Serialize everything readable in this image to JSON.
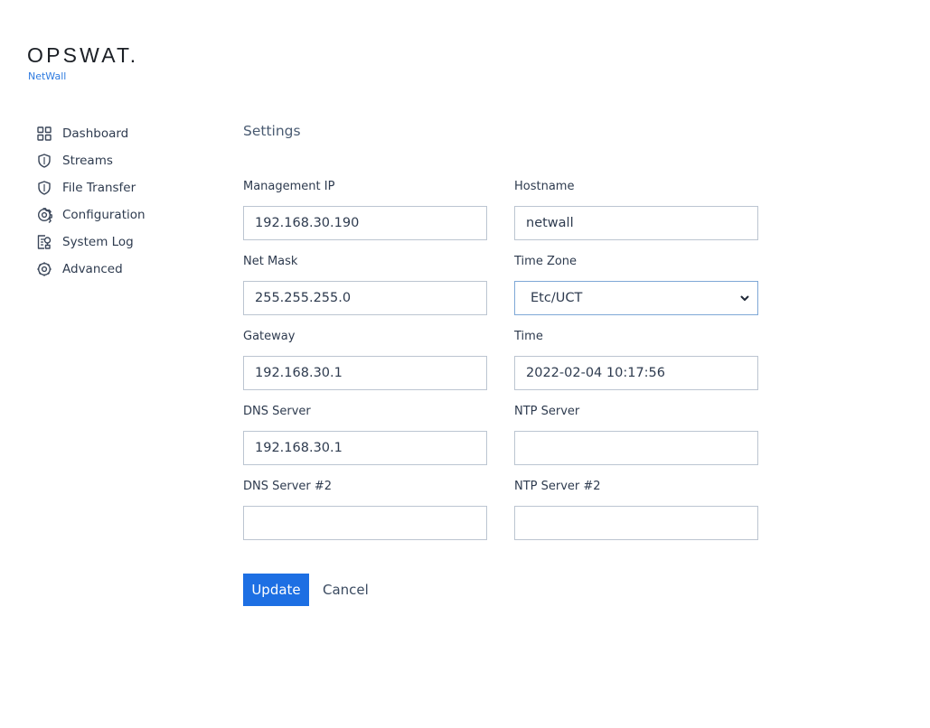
{
  "brand": {
    "logo_text": "OPSWAT.",
    "product": "NetWall"
  },
  "sidebar": {
    "items": [
      {
        "label": "Dashboard",
        "icon": "dashboard-grid-icon"
      },
      {
        "label": "Streams",
        "icon": "shield-icon"
      },
      {
        "label": "File Transfer",
        "icon": "shield-icon"
      },
      {
        "label": "Configuration",
        "icon": "gear-icon"
      },
      {
        "label": "System Log",
        "icon": "log-document-icon"
      },
      {
        "label": "Advanced",
        "icon": "gear-icon"
      }
    ]
  },
  "main": {
    "title": "Settings",
    "fields": {
      "management_ip": {
        "label": "Management IP",
        "value": "192.168.30.190"
      },
      "hostname": {
        "label": "Hostname",
        "value": "netwall"
      },
      "net_mask": {
        "label": "Net Mask",
        "value": "255.255.255.0"
      },
      "time_zone": {
        "label": "Time Zone",
        "value": "Etc/UCT"
      },
      "gateway": {
        "label": "Gateway",
        "value": "192.168.30.1"
      },
      "time": {
        "label": "Time",
        "value": "2022-02-04 10:17:56"
      },
      "dns_server": {
        "label": "DNS Server",
        "value": "192.168.30.1"
      },
      "ntp_server": {
        "label": "NTP Server",
        "value": ""
      },
      "dns_server_2": {
        "label": "DNS Server #2",
        "value": ""
      },
      "ntp_server_2": {
        "label": "NTP Server #2",
        "value": ""
      }
    },
    "actions": {
      "update_label": "Update",
      "cancel_label": "Cancel"
    }
  },
  "colors": {
    "accent": "#1d6fe3",
    "brand_product": "#2f7be0",
    "input_border": "#bcc5d1",
    "select_border": "#7fa8d6"
  }
}
